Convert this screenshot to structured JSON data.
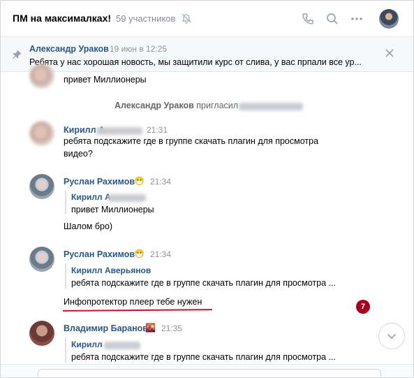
{
  "header": {
    "title": "ПМ на максималках!",
    "members": "59 участников"
  },
  "pinned": {
    "author": "Александр Ураков",
    "date": "19 июн в 12:25",
    "text": "Ребята у нас хорошая новость, мы защитили курс от слива, у вас прпали все ур..."
  },
  "messages": {
    "m0": {
      "text": "привет Миллионеры"
    },
    "service": {
      "actor": "Александр Ураков",
      "action": "пригласил"
    },
    "m1": {
      "author": "Кирилл А",
      "time": "21:31",
      "text1": "ребята подскажите где в группе скачать плагин для просмотра",
      "text2": "видео?"
    },
    "m2": {
      "author": "Руслан Рахимов",
      "emoji": "😷",
      "time": "21:34",
      "quote_author": "Кирилл А",
      "quote_text": "привет Миллионеры",
      "text": "Шалом бро)"
    },
    "m3": {
      "author": "Руслан Рахимов",
      "emoji": "😷",
      "time": "21:34",
      "quote_author": "Кирилл Аверьянов",
      "quote_text": "ребята подскажите где в группе скачать плагин для просмотра ...",
      "text": "Инфопротектор плеер тебе нужен"
    },
    "m4": {
      "author": "Владимир Баранов",
      "emoji": "🌇",
      "time": "21:35",
      "quote_author": "Кирилл",
      "quote_text": "ребята подскажите где в группе скачать плагин для просмотра ..."
    }
  },
  "unread_badge": "7",
  "icons": {
    "mute": "muted-bell-icon",
    "call": "phone-icon",
    "search": "search-icon",
    "more": "more-icon",
    "pin": "pin-icon",
    "close": "close-icon",
    "scroll": "chevron-down-icon"
  },
  "colors": {
    "link": "#2a5885",
    "badge": "#a40020",
    "underline": "#c8102e"
  }
}
